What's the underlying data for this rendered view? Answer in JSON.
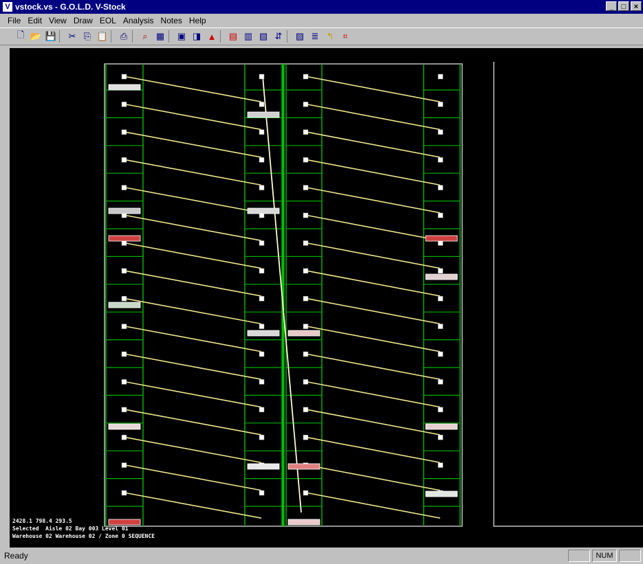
{
  "window": {
    "icon_label": "V",
    "title": "vstock.vs - G.O.L.D. V-Stock",
    "controls": [
      "_",
      "□",
      "×"
    ]
  },
  "menu": [
    "File",
    "Edit",
    "View",
    "Draw",
    "EOL",
    "Analysis",
    "Notes",
    "Help"
  ],
  "toolbar": {
    "icons": [
      "new-file-icon",
      "open-folder-icon",
      "save-icon",
      "sep",
      "cut-icon",
      "copy-icon",
      "paste-icon",
      "sep",
      "print-icon",
      "sep",
      "zoom-icon",
      "grid-icon",
      "sep",
      "layout-icon",
      "select-icon",
      "warning-icon",
      "sep",
      "aisle-icon",
      "rack-icon",
      "level-icon",
      "move-icon",
      "sep",
      "map-icon",
      "route-icon",
      "path-icon",
      "bounds-icon"
    ]
  },
  "canvas": {
    "info_lines": [
      "2428.1 798.4 293.5",
      "Selected  Aisle 02 Bay 003 Level 01",
      "Warehouse 02 Warehouse 02 / Zone 0 SEQUENCE"
    ]
  },
  "status": {
    "ready": "Ready",
    "panels": [
      "",
      "NUM",
      ""
    ]
  }
}
